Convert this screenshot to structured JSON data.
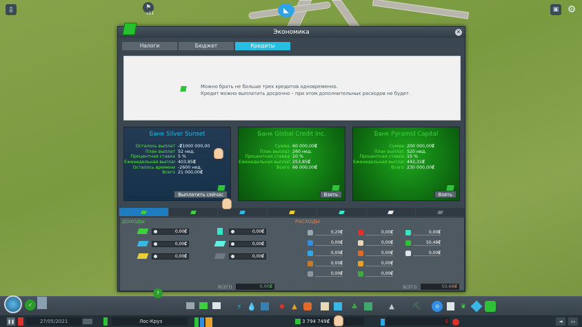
{
  "hud": {
    "version": "v11"
  },
  "window": {
    "title": "Экономика",
    "tabs": [
      {
        "label": "Налоги",
        "active": false
      },
      {
        "label": "Бюджет",
        "active": false
      },
      {
        "label": "Кредиты",
        "active": true
      }
    ],
    "info": {
      "line1": "Можно брать не больше трех кредитов одновременно.",
      "line2": "Кредит можно выплатить досрочно – при этом дополнительных расходов не будет."
    }
  },
  "banks": [
    {
      "name": "Банк Silver Sunset",
      "rows": [
        {
          "k": "Осталось выплат",
          "v": "-₡1000 000,00"
        },
        {
          "k": "План выплат",
          "v": "52 нед."
        },
        {
          "k": "Процентная ставка",
          "v": "5 %"
        },
        {
          "k": "Еженедельная выплата",
          "v": "403,85₡"
        },
        {
          "k": "Осталось времени",
          "v": "-2600 нед."
        },
        {
          "k": "Всего",
          "v": "21 000,00₡"
        }
      ],
      "button": "Выплатить сейчас"
    },
    {
      "name": "Банк Global Credit Inc.",
      "rows": [
        {
          "k": "Сумма",
          "v": "60 000,00₡"
        },
        {
          "k": "План выплат",
          "v": "260 нед."
        },
        {
          "k": "Процентная ставка",
          "v": "10 %"
        },
        {
          "k": "Еженедельная выплата",
          "v": "253,85₡"
        },
        {
          "k": "Всего",
          "v": "66 000,00₡"
        }
      ],
      "button": "Взять"
    },
    {
      "name": "Банк Pyramid Capital",
      "rows": [
        {
          "k": "Сумма",
          "v": "200 000,00₡"
        },
        {
          "k": "План выплат",
          "v": "520 нед."
        },
        {
          "k": "Процентная ставка",
          "v": "15 %"
        },
        {
          "k": "Еженедельная выплата",
          "v": "442,31₡"
        },
        {
          "k": "Всего",
          "v": "230 000,00₡"
        }
      ],
      "button": "Взять"
    }
  ],
  "budget": {
    "income_label": "ДОХОДЫ",
    "expense_label": "РАСХОДЫ",
    "total_label": "ВСЕГО",
    "income_total": "0,00₡",
    "expense_total": "50,68₡",
    "income": [
      {
        "icon": "residential-icon",
        "value": "0,00₡"
      },
      {
        "icon": "commercial-icon",
        "value": "0,00₡"
      },
      {
        "icon": "industrial-icon",
        "value": "0,00₡"
      },
      {
        "icon": "office-icon",
        "value": "0,00₡"
      },
      {
        "icon": "public-transport-icon",
        "value": "0,00₡"
      },
      {
        "icon": "tourism-icon",
        "value": "0,00₡"
      }
    ],
    "expenses": [
      {
        "icon": "road-icon",
        "value": "0,20₡"
      },
      {
        "icon": "electricity-icon",
        "value": "0,00₡"
      },
      {
        "icon": "water-icon",
        "value": "0,00₡"
      },
      {
        "icon": "garbage-icon",
        "value": "0,00₡"
      },
      {
        "icon": "monument-icon",
        "value": "0,00₡"
      },
      {
        "icon": "health-icon",
        "value": "0,00₡"
      },
      {
        "icon": "education-icon",
        "value": "0,00₡"
      },
      {
        "icon": "fire-icon",
        "value": "0,00₡"
      },
      {
        "icon": "police-icon",
        "value": "0,00₡"
      },
      {
        "icon": "park-icon",
        "value": "0,00₡"
      },
      {
        "icon": "transport-icon",
        "value": "0,00₡"
      },
      {
        "icon": "loan-icon",
        "value": "50,48₡"
      },
      {
        "icon": "policy-icon",
        "value": "0,00₡"
      }
    ]
  },
  "bottom": {
    "date": "27/05/2021",
    "city": "Лос-Круз",
    "money": "3 794 749₡",
    "income_rate": "0"
  },
  "colors": {
    "accent": "#28bde2",
    "green_bank": "#0e6a10",
    "gem": "#2fc238",
    "negative": "#ff4848"
  }
}
